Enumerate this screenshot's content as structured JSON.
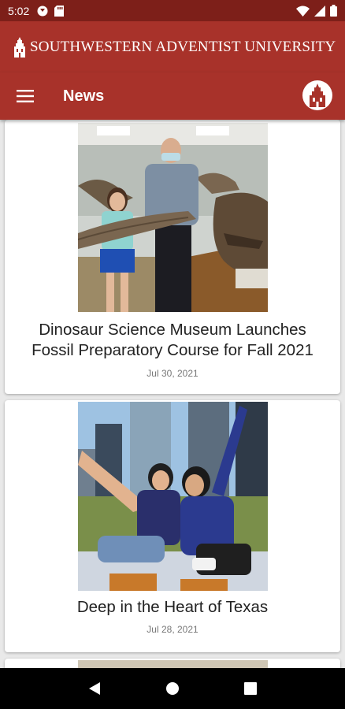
{
  "status_bar": {
    "time": "5:02",
    "icons": [
      "notification-icon",
      "sd-card-icon",
      "wifi-icon",
      "signal-icon",
      "battery-icon"
    ]
  },
  "brand": {
    "text": "SOUTHWESTERN ADVENTIST UNIVERSITY"
  },
  "app_bar": {
    "title": "News"
  },
  "articles": [
    {
      "headline_line1": "Dinosaur Science Museum Launches",
      "headline_line2": "Fossil Preparatory Course for Fall 2021",
      "date": "Jul 30, 2021",
      "image": "dinosaur-fossil-photo"
    },
    {
      "headline_line1": "Deep in the Heart of Texas",
      "date": "Jul 28, 2021",
      "image": "students-picnic-photo"
    }
  ],
  "colors": {
    "brand_red": "#a8322a",
    "status_bar": "#7d1f19"
  },
  "nav": {
    "icons": [
      "back-icon",
      "home-icon",
      "recents-icon"
    ]
  }
}
